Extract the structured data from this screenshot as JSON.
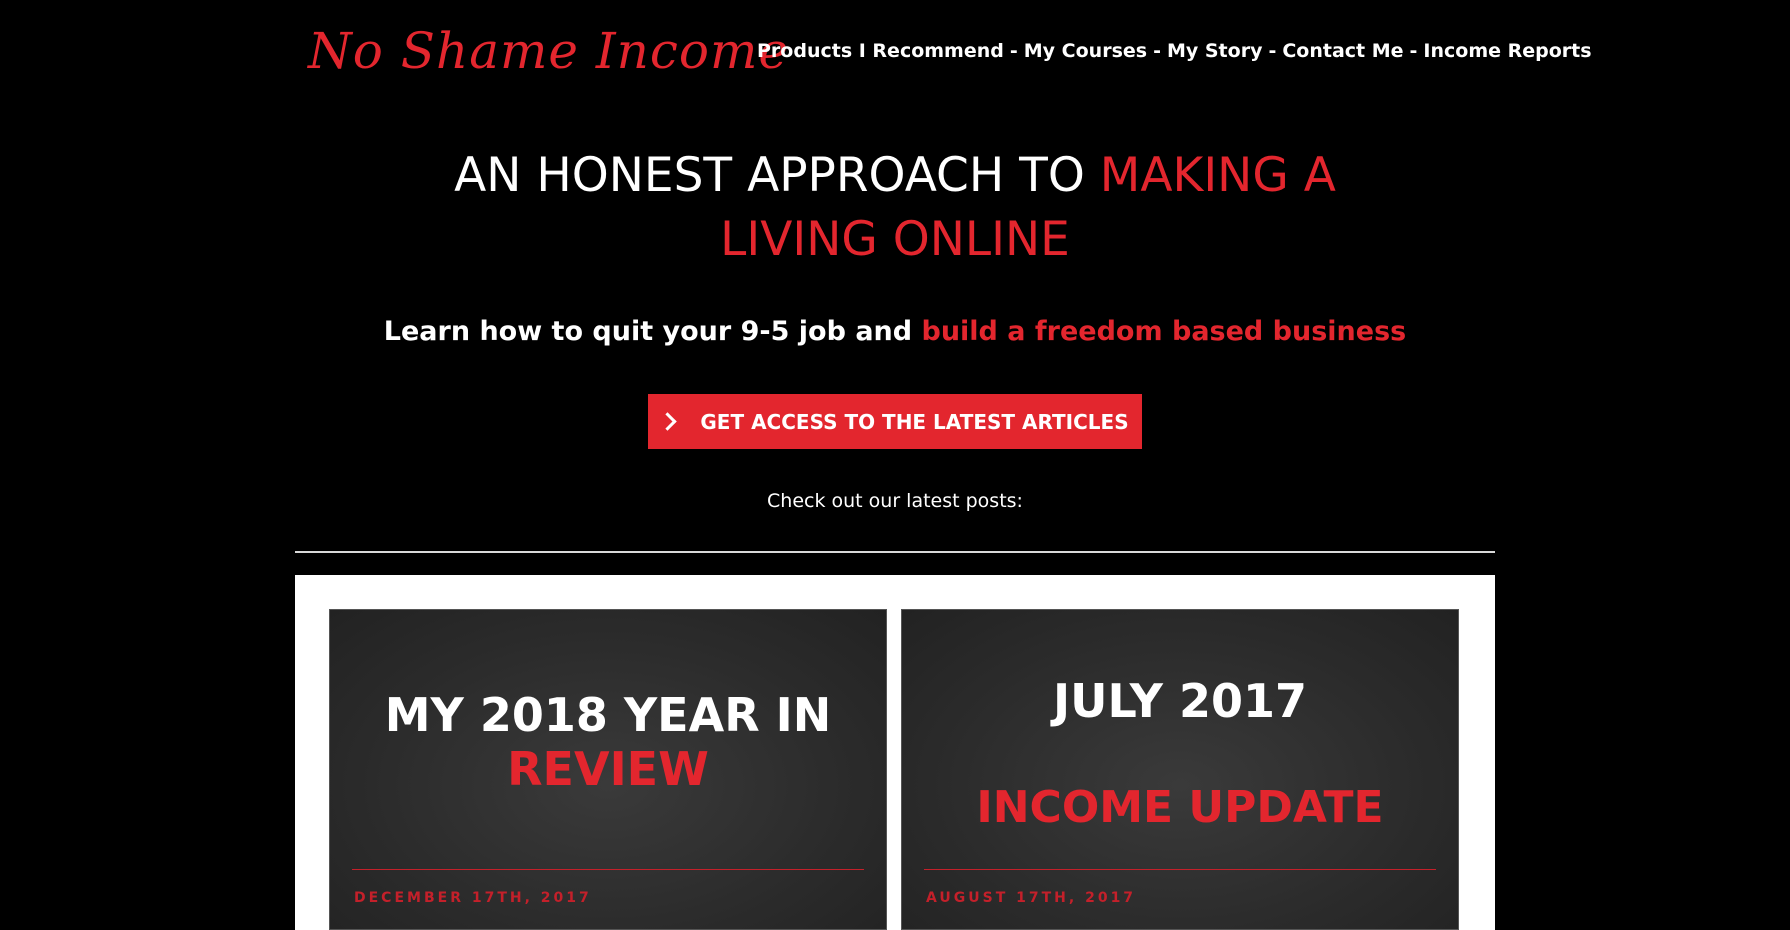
{
  "header": {
    "logo_text": "No Shame Income",
    "nav": [
      {
        "label": "Products I Recommend"
      },
      {
        "label": "My Courses"
      },
      {
        "label": "My Story"
      },
      {
        "label": "Contact Me"
      },
      {
        "label": "Income Reports"
      }
    ],
    "nav_separator": "-"
  },
  "hero": {
    "headline_white": "AN HONEST APPROACH TO ",
    "headline_red_1": "MAKING A",
    "headline_red_2": "LIVING ONLINE",
    "subhead_white": "Learn how to quit your 9-5 job and ",
    "subhead_red": "build a freedom based business",
    "cta_label": "GET ACCESS TO THE LATEST ARTICLES",
    "latest_label": "Check out our latest posts:"
  },
  "posts": [
    {
      "title_line_1": "MY 2018 YEAR IN",
      "title_line_2": "REVIEW",
      "date": "DECEMBER 17TH, 2017"
    },
    {
      "title_line_1": "JULY 2017",
      "title_line_2": "INCOME UPDATE",
      "date": "AUGUST 17TH, 2017"
    }
  ],
  "colors": {
    "background": "#000000",
    "accent": "#e3262e",
    "text": "#ffffff",
    "panel": "#ffffff"
  }
}
